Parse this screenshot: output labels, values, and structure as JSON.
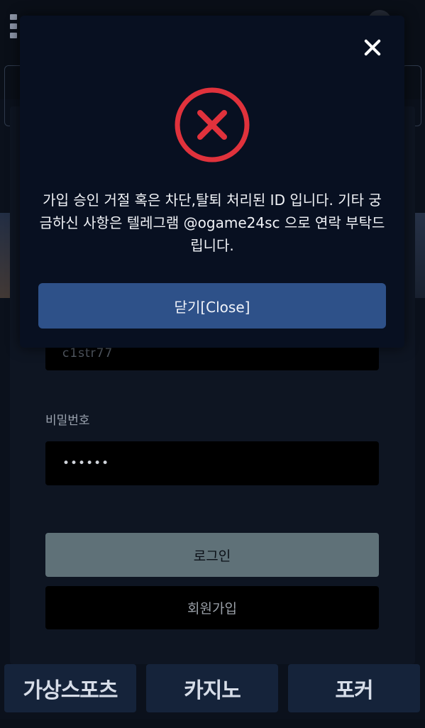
{
  "modal": {
    "message": "가입 승인 거절 혹은 차단,탈퇴 처리된 ID 입니다. 기타 궁금하신 사항은 텔레그램 @ogame24sc 으로 연락 부탁드립니다.",
    "close_button": "닫기[Close]",
    "error_color": "#e0323c"
  },
  "login": {
    "id_value": "c1str77",
    "password_label": "비밀번호",
    "password_value": "••••••",
    "login_button": "로그인",
    "signup_button": "회원가입"
  },
  "categories": [
    "가상스포츠",
    "카지노",
    "포커"
  ]
}
